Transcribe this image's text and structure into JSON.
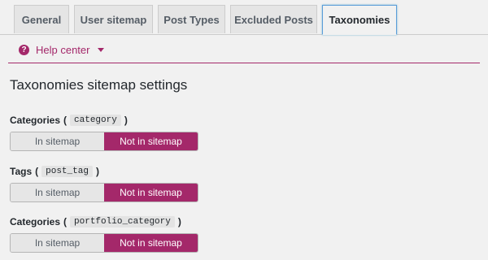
{
  "tabs": [
    {
      "label": "General",
      "active": false
    },
    {
      "label": "User sitemap",
      "active": false
    },
    {
      "label": "Post Types",
      "active": false
    },
    {
      "label": "Excluded Posts",
      "active": false
    },
    {
      "label": "Taxonomies",
      "active": true
    }
  ],
  "help": {
    "label": "Help center",
    "icon": "question-circle-icon"
  },
  "section_title": "Taxonomies sitemap settings",
  "settings": [
    {
      "label": "Categories",
      "code": "category",
      "options": [
        "In sitemap",
        "Not in sitemap"
      ],
      "selected": "Not in sitemap"
    },
    {
      "label": "Tags",
      "code": "post_tag",
      "options": [
        "In sitemap",
        "Not in sitemap"
      ],
      "selected": "Not in sitemap"
    },
    {
      "label": "Categories",
      "code": "portfolio_category",
      "options": [
        "In sitemap",
        "Not in sitemap"
      ],
      "selected": "Not in sitemap"
    }
  ],
  "colors": {
    "accent": "#a4286a",
    "active_tab_border": "#5b9dd9",
    "background": "#f1f1f1"
  }
}
